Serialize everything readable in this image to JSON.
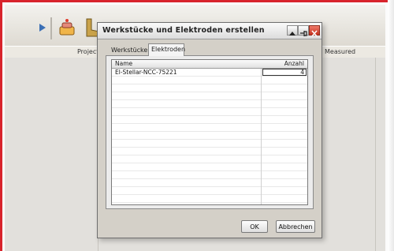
{
  "app": {
    "columns": {
      "project": "Project",
      "measured": "Measured"
    },
    "toolbar_icons": [
      "tool-arrow-icon",
      "cake-icon",
      "boot-icon"
    ]
  },
  "dialog": {
    "title": "Werkstücke und Elektroden erstellen",
    "tabs": [
      {
        "label": "Werkstücke",
        "active": false
      },
      {
        "label": "Elektroden",
        "active": true
      }
    ],
    "list": {
      "headers": {
        "name": "Name",
        "anzahl": "Anzahl"
      },
      "rows": [
        {
          "name": "El-Stellar-NCC-75221",
          "anzahl": "4"
        }
      ]
    },
    "buttons": {
      "ok": "OK",
      "cancel": "Abbrechen"
    },
    "title_buttons": [
      "up-arrow-icon",
      "pin-icon",
      "close-icon"
    ]
  },
  "colors": {
    "frame_border": "#d8242c",
    "close_button": "#c4311f"
  }
}
